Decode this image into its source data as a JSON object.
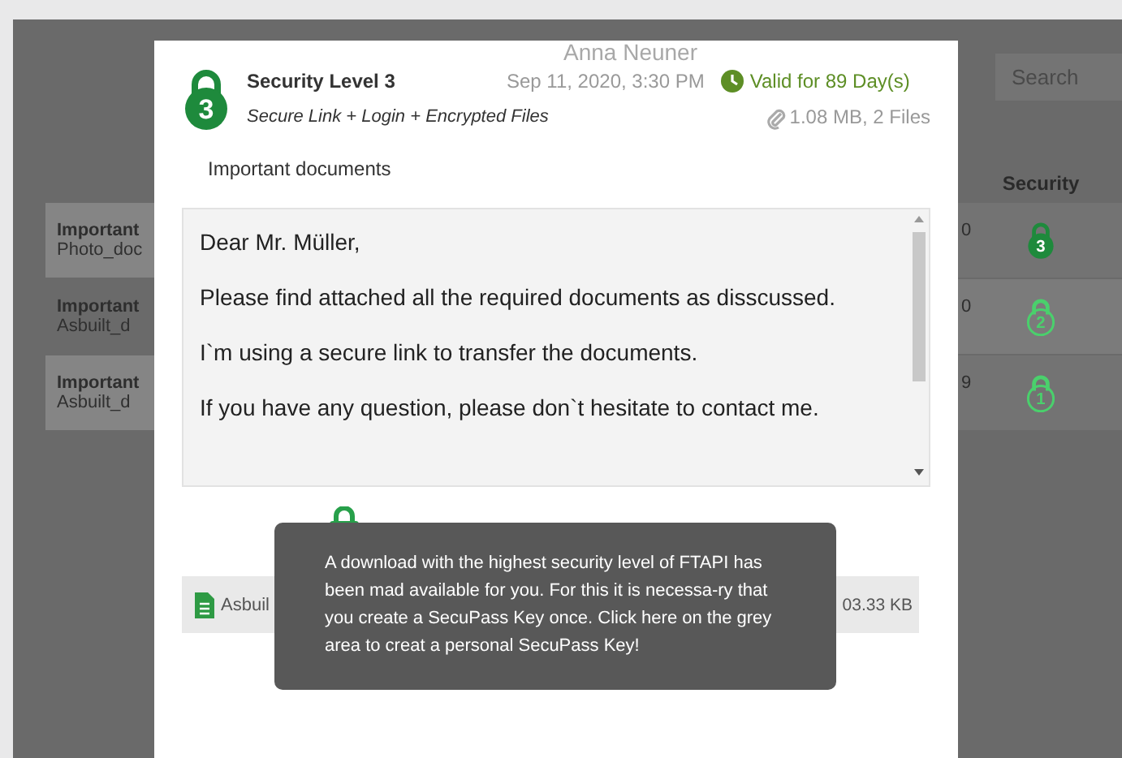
{
  "background": {
    "search": {
      "placeholder": "Search"
    },
    "column_header": "Security",
    "rows": [
      {
        "title": "Important",
        "file": "Photo_doc",
        "column_3": "0",
        "lock_number": "3",
        "kind": "filled",
        "highlighted": true
      },
      {
        "title": "Important",
        "file": "Asbuilt_d",
        "column_3": "0",
        "lock_number": "2",
        "kind": "outline",
        "highlighted": false
      },
      {
        "title": "Important",
        "file": "Asbuilt_d",
        "column_3": "9",
        "lock_number": "1",
        "kind": "outline",
        "highlighted": true
      }
    ]
  },
  "modal": {
    "sender": "Anna Neuner",
    "lock_number": "3",
    "title": "Security Level 3",
    "subtitle": "Secure Link + Login + Encrypted Files",
    "date": "Sep 11, 2020, 3:30 PM",
    "validity": "Valid for 89 Day(s)",
    "files_summary": "1.08 MB, 2 Files",
    "subject": "Important documents",
    "message": [
      "Dear Mr. Müller,",
      "Please find attached all the required documents as disscussed.",
      "I`m using a secure link to transfer the documents.",
      "If you have any question, please don`t hesitate to contact me."
    ],
    "attachment": {
      "name": "Asbuil",
      "size": "03.33 KB"
    },
    "tooltip": {
      "text": "A download with the highest security level of FTAPI has been mad available for you. For this it is necessa-ry that you create a SecuPass Key once. Click here on the grey area to creat a personal SecuPass Key!"
    }
  }
}
